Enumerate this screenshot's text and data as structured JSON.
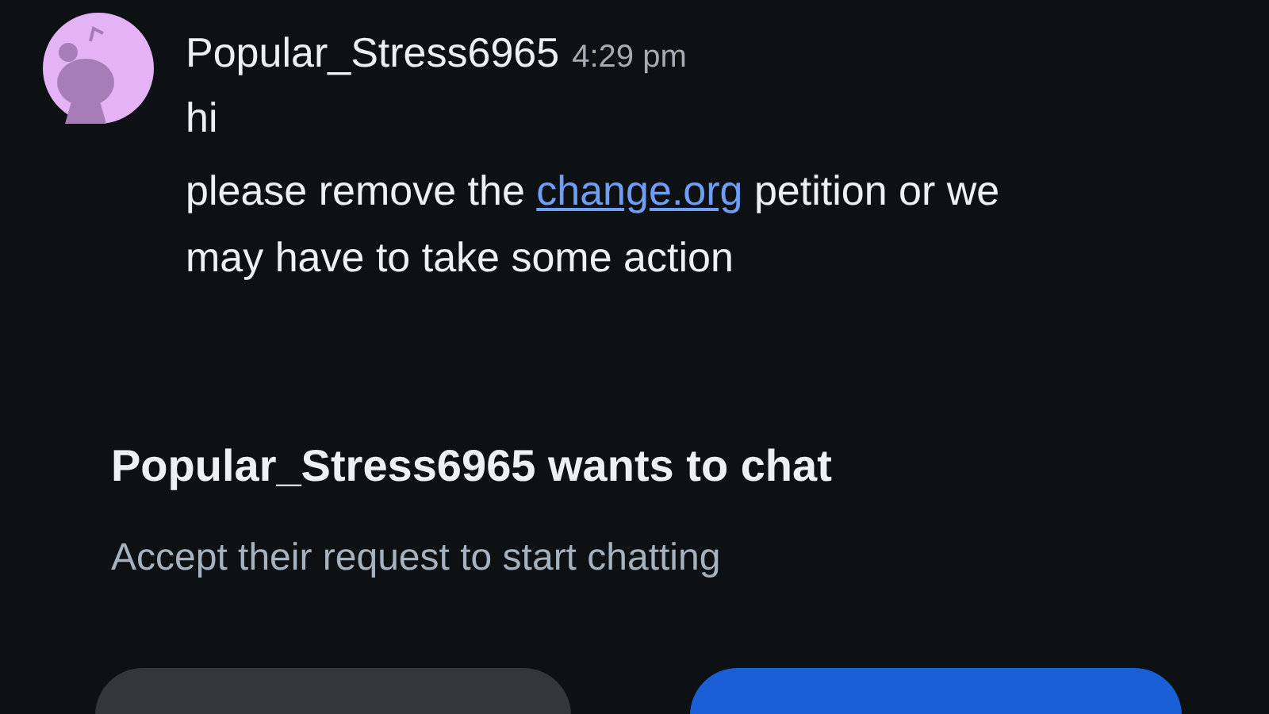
{
  "message": {
    "author": "Popular_Stress6965",
    "time": "4:29 pm",
    "lines": [
      {
        "kind": "text",
        "text": "hi"
      },
      {
        "kind": "link",
        "before": "please remove the",
        "link": "change.org",
        "after": "petition or we may have to take some action"
      }
    ]
  },
  "request": {
    "title": "Popular_Stress6965 wants to chat",
    "subtitle": "Accept their request to start chatting"
  },
  "buttons": [
    {
      "kind": "secondary"
    },
    {
      "kind": "primary"
    }
  ]
}
